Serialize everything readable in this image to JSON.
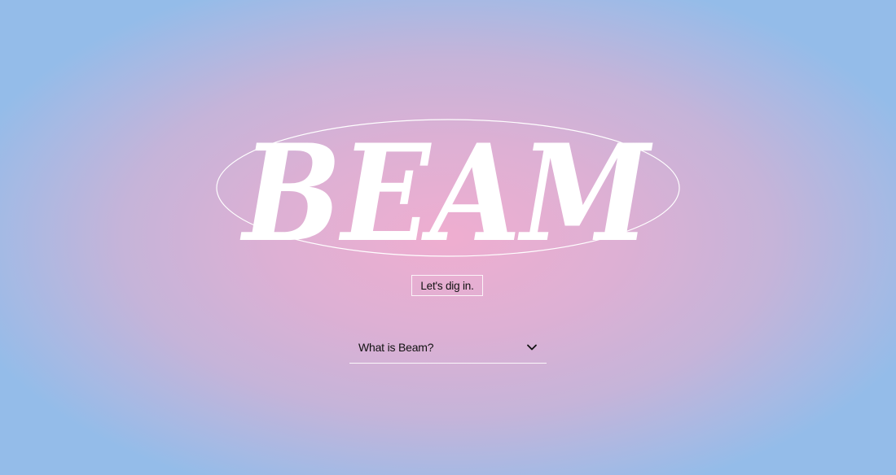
{
  "brand": {
    "logo_text": "BEAM"
  },
  "hero": {
    "cta_label": "Let's dig in."
  },
  "faq": {
    "items": [
      {
        "question": "What is Beam?",
        "expanded": false
      }
    ]
  },
  "colors": {
    "center": "#efaed0",
    "edge": "#94bce9",
    "logo": "#ffffff",
    "text": "#111111"
  }
}
